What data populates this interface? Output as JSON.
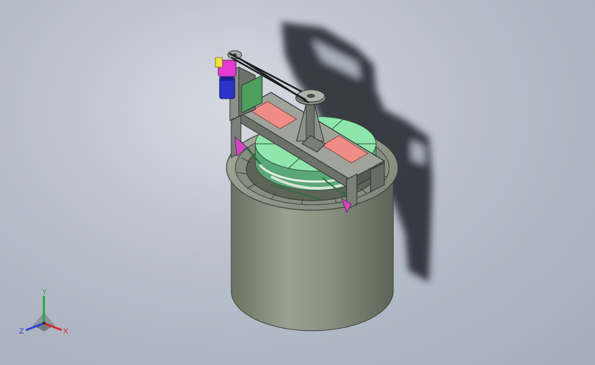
{
  "viewport": {
    "background_top": "#d6dae2",
    "background_bottom": "#a4acba"
  },
  "model": {
    "colors": {
      "tank_body": "#8a9180",
      "tank_shadow": "#1e2126",
      "frame": "#8c8f8a",
      "frame_dark": "#4b4e4a",
      "rotor": "#8fe6ac",
      "rotor_dark": "#6bc48d",
      "pads": "#f08c86",
      "motor_magenta": "#e23bd2",
      "motor_blue": "#2b34c8",
      "motor_yellow": "#f0e33a",
      "belt": "#1c1c1c"
    }
  },
  "triad": {
    "x_label": "X",
    "y_label": "Y",
    "z_label": "Z",
    "x_color": "#d42a2a",
    "y_color": "#1fa83c",
    "z_color": "#2a44d4"
  }
}
